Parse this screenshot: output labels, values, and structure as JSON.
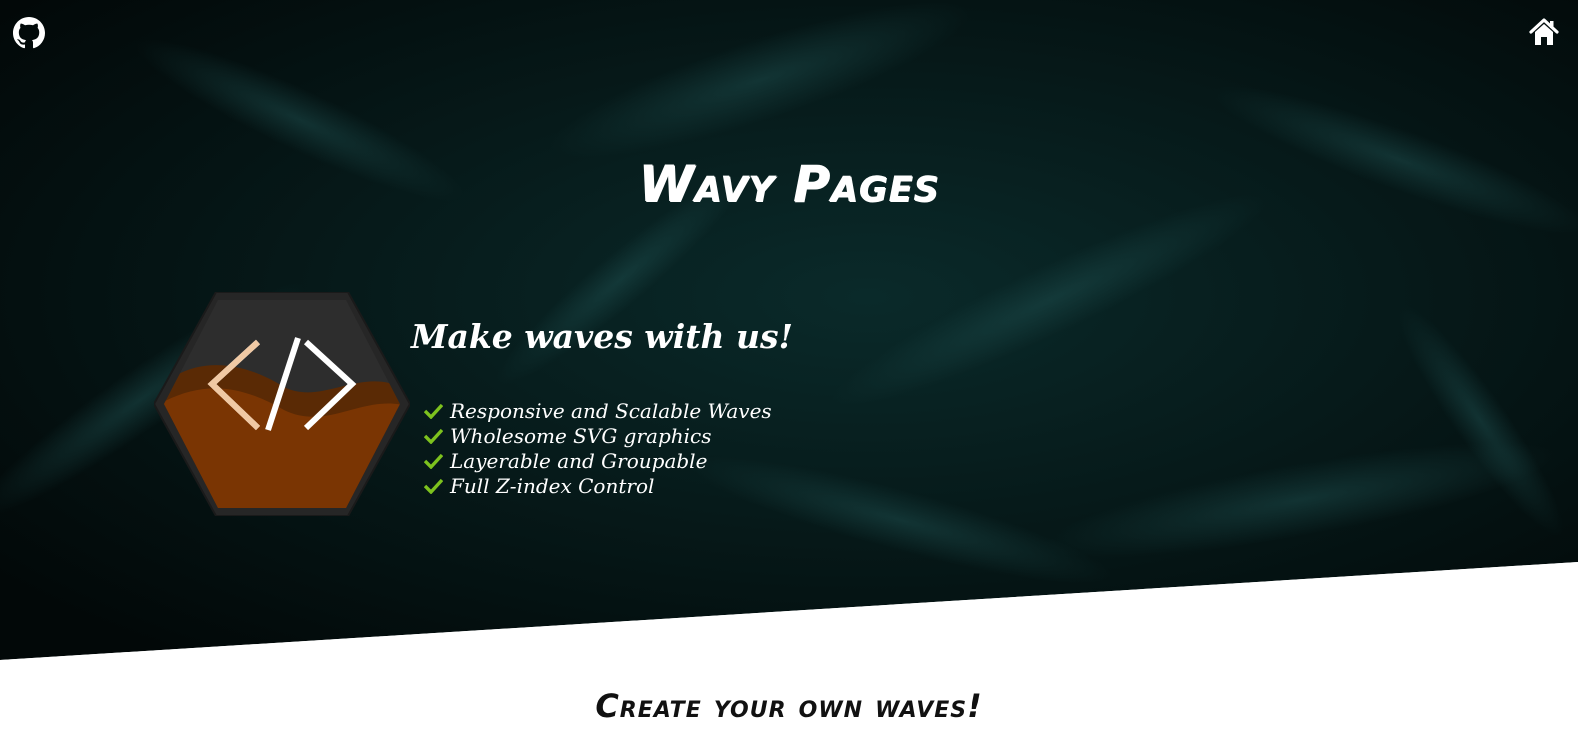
{
  "header": {
    "github_icon": "github-icon",
    "home_icon": "home-icon"
  },
  "hero": {
    "title": "Wavy Pages",
    "tagline": "Make waves with us!",
    "features": [
      "Responsive and Scalable Waves",
      "Wholesome SVG graphics",
      "Layerable and Groupable",
      "Full Z-index Control"
    ],
    "feature_icon": "check-icon"
  },
  "logo": {
    "icon": "code-brackets-icon",
    "hex_color": "#2b2b2b",
    "wave_color": "#7a3503"
  },
  "section": {
    "title": "Create your own waves!"
  },
  "colors": {
    "hero_bg": "#041614",
    "accent_check": "#7dc21e",
    "text_light": "#ffffff",
    "text_dark": "#111111"
  }
}
